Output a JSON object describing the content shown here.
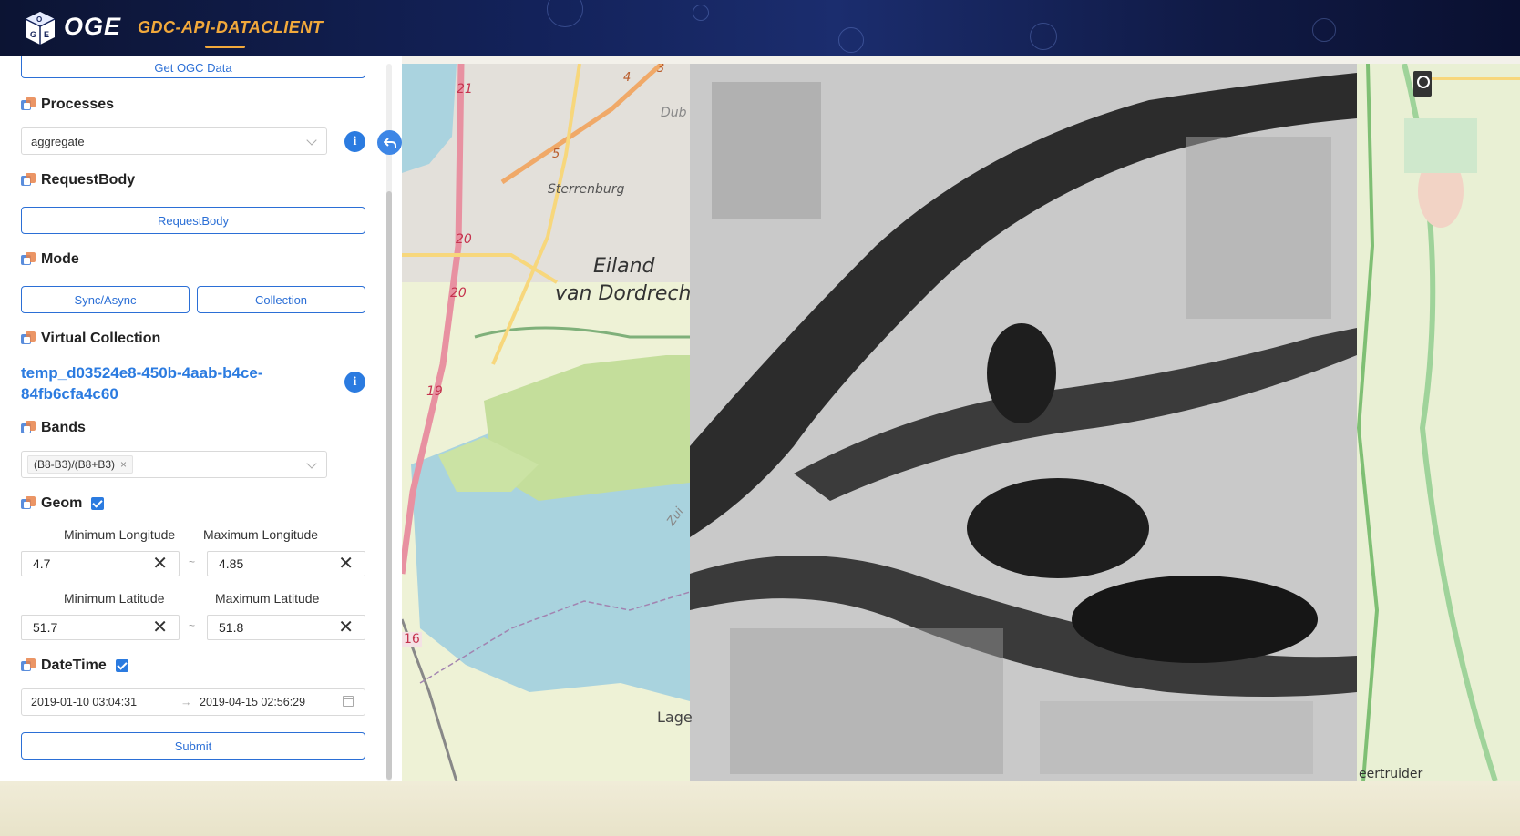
{
  "header": {
    "logo_icon": "cube-logo-icon",
    "logo_text": "OGE",
    "app_tab": "GDC-API-DATACLIENT"
  },
  "panel": {
    "get_ogc_data_label": "Get OGC Data",
    "processes": {
      "title": "Processes",
      "selected": "aggregate",
      "info_glyph": "i"
    },
    "request_body": {
      "title": "RequestBody",
      "button_label": "RequestBody"
    },
    "mode": {
      "title": "Mode",
      "sync_label": "Sync/Async",
      "collection_label": "Collection"
    },
    "virtual_collection": {
      "title": "Virtual Collection",
      "id_line1": "temp_d03524e8-450b-4aab-b4ce-",
      "id_line2": "84fb6cfa4c60",
      "info_glyph": "i"
    },
    "bands": {
      "title": "Bands",
      "selected_tag": "(B8-B3)/(B8+B3)",
      "tag_close": "×"
    },
    "geom": {
      "title": "Geom",
      "checked": true,
      "min_lon_label": "Minimum Longitude",
      "max_lon_label": "Maximum Longitude",
      "min_lon": "4.7",
      "max_lon": "4.85",
      "min_lat_label": "Minimum Latitude",
      "max_lat_label": "Maximum Latitude",
      "min_lat": "51.7",
      "max_lat": "51.8",
      "separator": "~",
      "clear_glyph": "✕"
    },
    "datetime": {
      "title": "DateTime",
      "checked": true,
      "start": "2019-01-10 03:04:31",
      "arrow": "→",
      "end": "2019-04-15 02:56:29"
    },
    "submit_label": "Submit"
  },
  "map": {
    "labels": {
      "eiland_line1": "Eiland",
      "eiland_line2": "van Dordrech",
      "sterrenburg": "Sterrenburg",
      "dub": "Dub",
      "lage": "Lage",
      "eertruider": "eertruider",
      "zui": "Zui",
      "road_21": "21",
      "road_20a": "20",
      "road_20b": "20",
      "road_19": "19",
      "road_16": "16",
      "road_4": "4",
      "road_5": "5",
      "road_3": "3"
    }
  },
  "colors": {
    "accent": "#2b7be0",
    "header_bg": "#13225a",
    "tab_active": "#f2a93b"
  }
}
